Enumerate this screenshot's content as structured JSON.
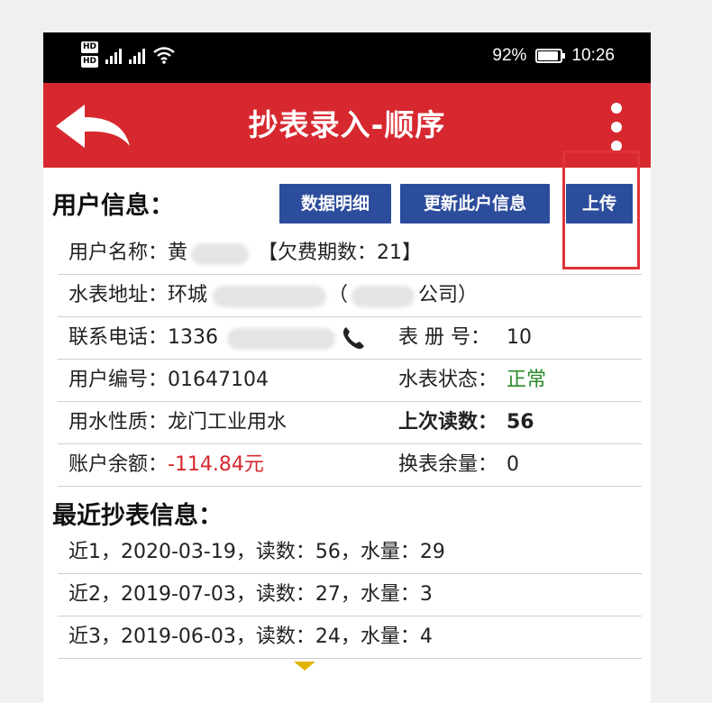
{
  "status_bar": {
    "hd_labels": [
      "HD",
      "HD"
    ],
    "battery": "92%",
    "time": "10:26"
  },
  "app_bar": {
    "title": "抄表录入-顺序"
  },
  "user_info": {
    "section_title": "用户信息：",
    "buttons": {
      "detail": "数据明细",
      "update": "更新此户信息",
      "upload": "上传"
    },
    "name_label": "用户名称：",
    "name_value": "黄",
    "arrears": "【欠费期数：21】",
    "address_label": "水表地址：",
    "address_value_start": "环城",
    "address_value_end": "（",
    "address_value_tail": "公司）",
    "phone_label": "联系电话：",
    "phone_value": "1336",
    "meter_no_label": "表 册 号：",
    "meter_no_value": "10",
    "user_no_label": "用户编号：",
    "user_no_value": "01647104",
    "meter_status_label": "水表状态：",
    "meter_status_value": "正常",
    "water_type_label": "用水性质：",
    "water_type_value": "龙门工业用水",
    "last_reading_label": "上次读数：",
    "last_reading_value": "56",
    "balance_label": "账户余额：",
    "balance_value": "-114.84元",
    "swap_remain_label": "换表余量：",
    "swap_remain_value": "0"
  },
  "recent": {
    "section_title": "最近抄表信息：",
    "items": [
      "近1，2020-03-19，读数：56，水量：29",
      "近2，2019-07-03，读数：27，水量：3",
      "近3，2019-06-03，读数：24，水量：4"
    ]
  },
  "colors": {
    "app_bar": "#d7282f",
    "button": "#2c4c9c",
    "negative": "#d7282f",
    "status_ok": "#2b8a2b",
    "highlight_outline": "#e03438"
  }
}
